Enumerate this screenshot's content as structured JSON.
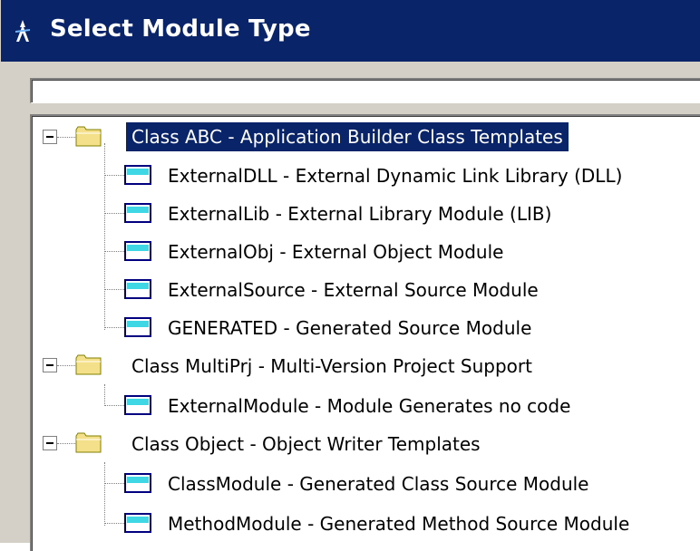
{
  "window": {
    "title": "Select Module Type"
  },
  "search": {
    "value": ""
  },
  "tree": {
    "groups": [
      {
        "label": "Class ABC - Application Builder Class Templates",
        "selected": true,
        "expanded": true,
        "children": [
          "ExternalDLL - External Dynamic Link Library (DLL)",
          "ExternalLib - External Library Module (LIB)",
          "ExternalObj - External Object Module",
          "ExternalSource - External Source Module",
          "GENERATED - Generated Source Module"
        ]
      },
      {
        "label": "Class MultiPrj - Multi-Version Project Support",
        "selected": false,
        "expanded": true,
        "children": [
          "ExternalModule - Module Generates no code"
        ]
      },
      {
        "label": "Class Object - Object Writer Templates",
        "selected": false,
        "expanded": true,
        "children": [
          "ClassModule - Generated Class Source Module",
          "MethodModule - Generated Method Source Module"
        ]
      }
    ]
  },
  "colors": {
    "titlebar": "#0a246a",
    "selection": "#0a246a",
    "folder": "#f4e08a",
    "module": "#3fd6e6"
  },
  "icons": {
    "title": "app-icon",
    "group": "folder-icon",
    "item": "module-icon",
    "expander": "collapse-minus-icon"
  }
}
